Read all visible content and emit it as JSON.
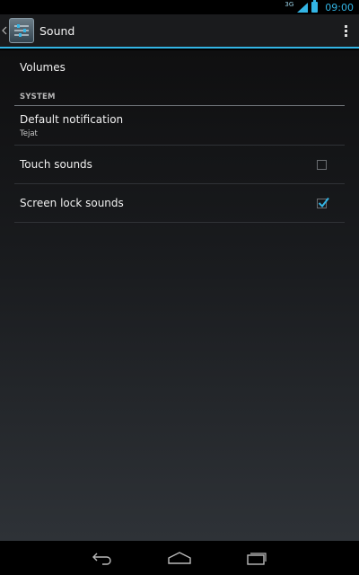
{
  "status_bar": {
    "network": "3G",
    "time": "09:00"
  },
  "action_bar": {
    "title": "Sound",
    "icons": {
      "up": "chevron-left-icon",
      "app": "sliders-icon",
      "overflow": "overflow-menu-icon"
    }
  },
  "settings": {
    "volumes_label": "Volumes",
    "section_header": "SYSTEM",
    "default_notification": {
      "label": "Default notification",
      "value": "Tejat"
    },
    "touch_sounds": {
      "label": "Touch sounds",
      "checked": false
    },
    "screen_lock_sounds": {
      "label": "Screen lock sounds",
      "checked": true
    }
  },
  "colors": {
    "accent": "#33b5e5",
    "action_bar_bg": "#1a1b1d",
    "text_primary": "#f0f0f0"
  },
  "nav_bar": {
    "icons": [
      "back-icon",
      "home-icon",
      "recent-apps-icon"
    ]
  }
}
